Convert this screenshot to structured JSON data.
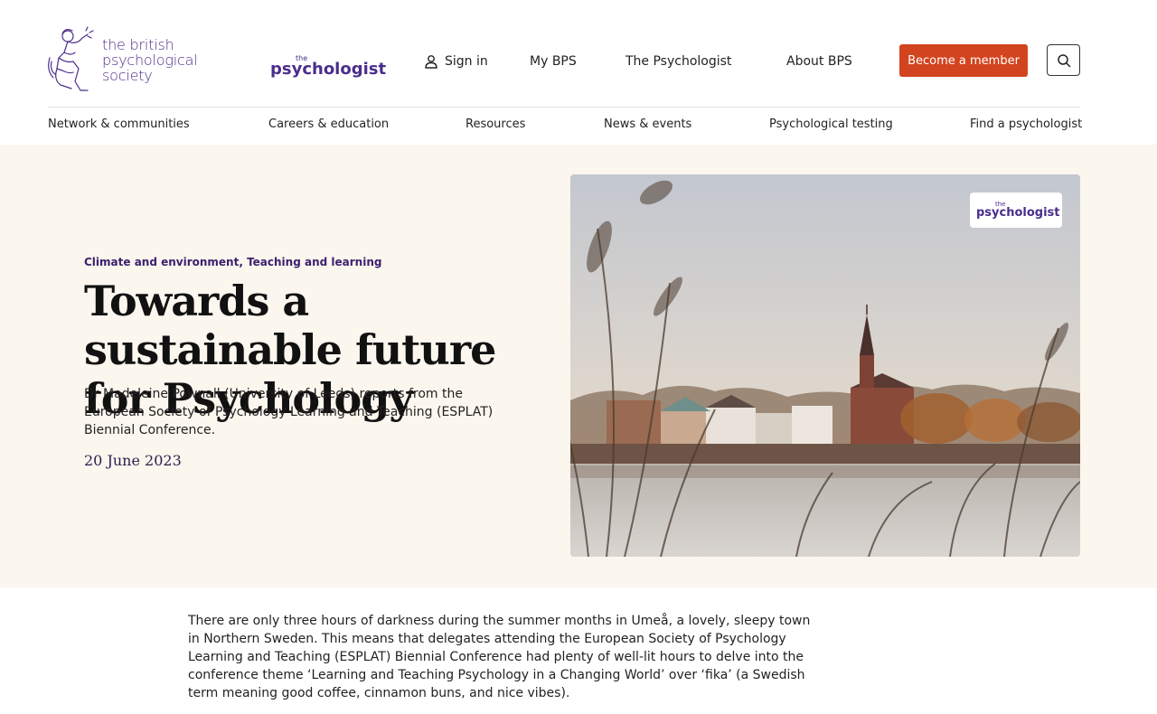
{
  "header": {
    "bps_logo_line1": "the british",
    "bps_logo_line2": "psychological society",
    "psychologist_logo_the": "the",
    "psychologist_logo_name": "psychologist",
    "sign_in": "Sign in",
    "my_bps": "My BPS",
    "the_psychologist": "The Psychologist",
    "about_bps": "About BPS",
    "become_member": "Become a member"
  },
  "main_nav": [
    "Network & communities",
    "Careers & education",
    "Resources",
    "News & events",
    "Psychological testing",
    "Find a psychologist"
  ],
  "article": {
    "categories": "Climate and environment, Teaching and learning",
    "title": "Towards a sustainable future for Psychology",
    "summary": "Dr Madeleine Pownall (University of Leeds) reports from the European Society of Psychology Learning and Teaching (ESPLAT) Biennial Conference.",
    "date": "20 June 2023",
    "image_badge_the": "the",
    "image_badge_name": "psychologist",
    "body": "There are only three hours of darkness during the summer months in Umeå, a lovely, sleepy town in Northern Sweden. This means that delegates attending the European Society of Psychology Learning and Teaching (ESPLAT) Biennial Conference had plenty of well-lit hours to delve into the conference theme ‘Learning and Teaching Psychology in a Changing World’ over ‘fika’ (a Swedish term meaning good coffee, cinnamon buns, and nice vibes)."
  },
  "icons": {
    "user": "user-icon",
    "search": "search-icon",
    "logo": "psyche-figure-icon"
  },
  "colors": {
    "brand_purple": "#4b2d8c",
    "member_button": "#d2441f",
    "hero_background": "#fbf6ee"
  }
}
